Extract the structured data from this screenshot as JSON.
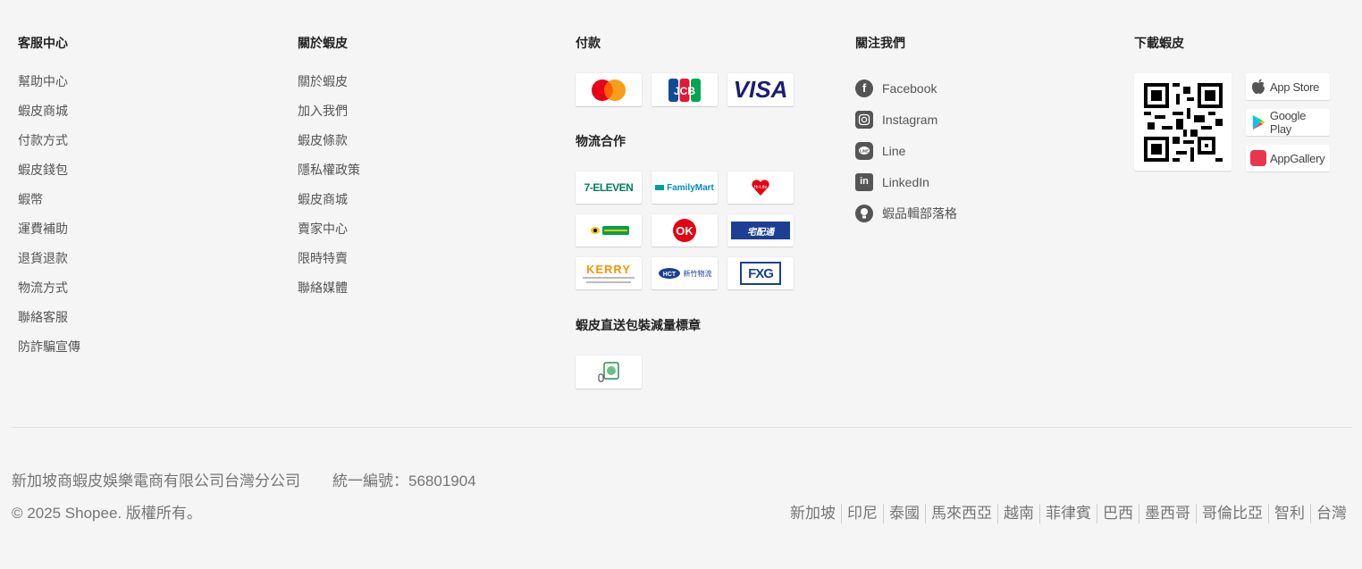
{
  "customer_service": {
    "title": "客服中心",
    "links": [
      "幫助中心",
      "蝦皮商城",
      "付款方式",
      "蝦皮錢包",
      "蝦幣",
      "運費補助",
      "退貨退款",
      "物流方式",
      "聯絡客服",
      "防詐騙宣傳"
    ]
  },
  "about": {
    "title": "關於蝦皮",
    "links": [
      "關於蝦皮",
      "加入我們",
      "蝦皮條款",
      "隱私權政策",
      "蝦皮商城",
      "賣家中心",
      "限時特賣",
      "聯絡媒體"
    ]
  },
  "payment": {
    "title": "付款",
    "logos": [
      {
        "name": "mastercard-logo",
        "label": ""
      },
      {
        "name": "jcb-logo",
        "label": "JCB"
      },
      {
        "name": "visa-logo",
        "label": "VISA"
      }
    ]
  },
  "logistics": {
    "title": "物流合作",
    "logos": [
      {
        "name": "7-eleven-logo",
        "label": "7-ELEVEN"
      },
      {
        "name": "familymart-logo",
        "label": "FamilyMart"
      },
      {
        "name": "hilife-logo",
        "label": "Hi-Life"
      },
      {
        "name": "black-cat-logo",
        "label": ""
      },
      {
        "name": "ok-mart-logo",
        "label": "OK"
      },
      {
        "name": "takkyubin-logo",
        "label": "宅配通"
      },
      {
        "name": "kerry-express-logo",
        "label": "KERRY"
      },
      {
        "name": "hct-logistics-logo",
        "label": "新竹物流"
      },
      {
        "name": "fxg-logo",
        "label": "FXG"
      }
    ]
  },
  "packaging": {
    "title": "蝦皮直送包裝減量標章"
  },
  "follow": {
    "title": "關注我們",
    "items": [
      {
        "label": "Facebook",
        "icon": "facebook-icon"
      },
      {
        "label": "Instagram",
        "icon": "instagram-icon"
      },
      {
        "label": "Line",
        "icon": "line-icon"
      },
      {
        "label": "LinkedIn",
        "icon": "linkedin-icon"
      },
      {
        "label": "蝦品輯部落格",
        "icon": "blog-icon"
      }
    ]
  },
  "download": {
    "title": "下載蝦皮",
    "stores": [
      "App Store",
      "Google Play",
      "AppGallery"
    ]
  },
  "footer": {
    "company": "新加坡商蝦皮娛樂電商有限公司台灣分公司",
    "tax_id": "統一編號：56801904",
    "copyright": "© 2025 Shopee. 版權所有。",
    "countries": [
      "新加坡",
      "印尼",
      "泰國",
      "馬來西亞",
      "越南",
      "菲律賓",
      "巴西",
      "墨西哥",
      "哥倫比亞",
      "智利",
      "台灣"
    ]
  },
  "colors": {
    "background": "#f5f5f5",
    "text_muted": "#757575",
    "shopee_orange": "#ee4d2d"
  }
}
